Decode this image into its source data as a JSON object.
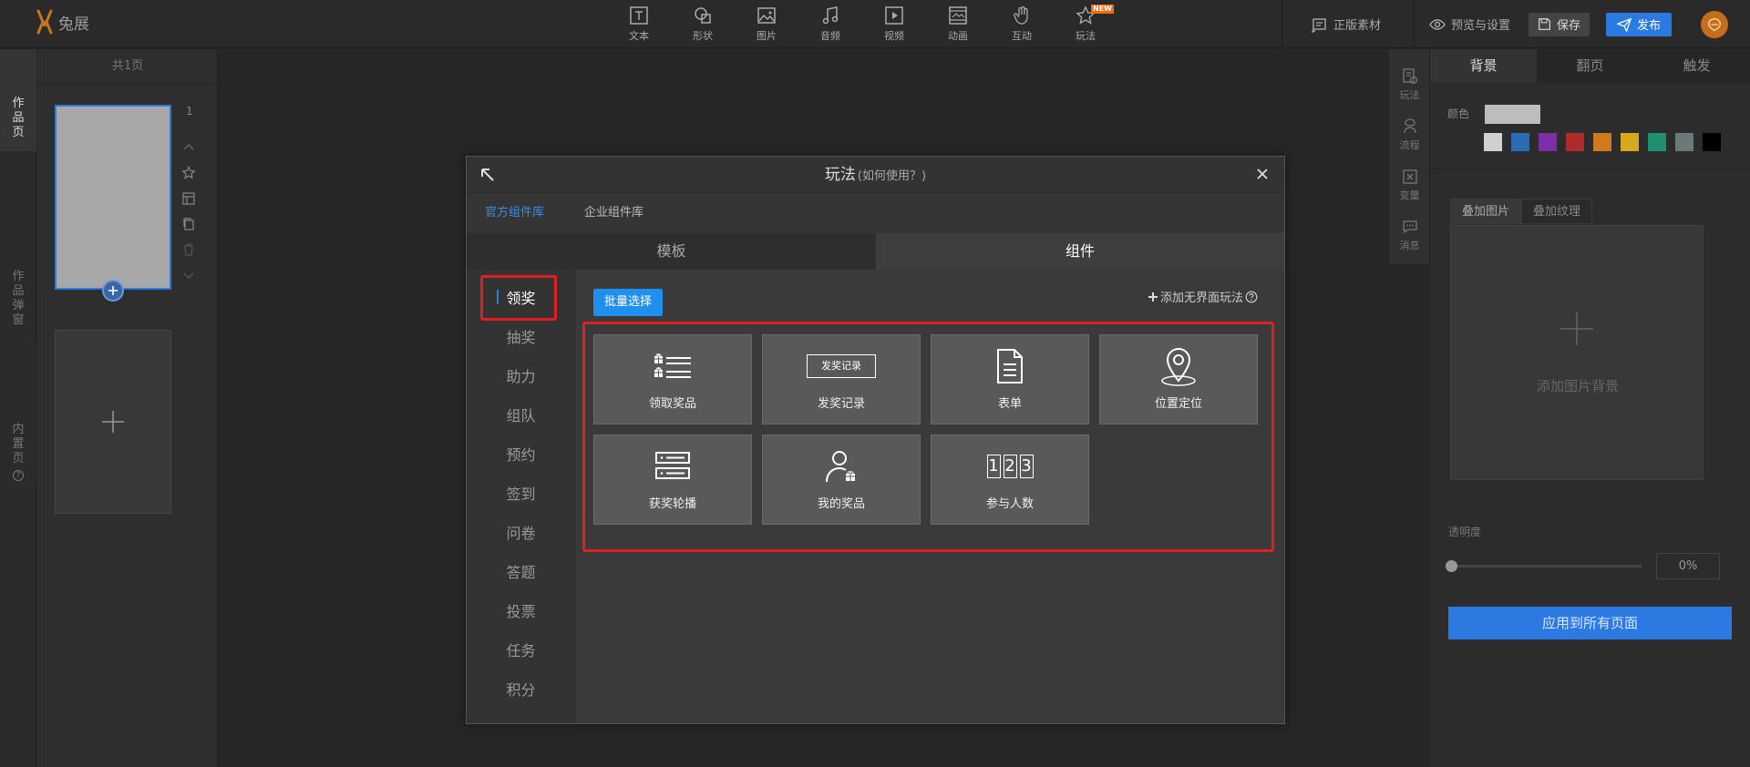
{
  "app": {
    "logo_text": "兔展"
  },
  "toolbar": {
    "tools": [
      {
        "label": "文本",
        "icon": "text-icon"
      },
      {
        "label": "形状",
        "icon": "shape-icon"
      },
      {
        "label": "图片",
        "icon": "image-icon"
      },
      {
        "label": "音频",
        "icon": "music-icon"
      },
      {
        "label": "视频",
        "icon": "video-icon"
      },
      {
        "label": "动画",
        "icon": "animation-icon"
      },
      {
        "label": "互动",
        "icon": "hand-icon"
      },
      {
        "label": "玩法",
        "icon": "star-icon",
        "badge": "NEW"
      }
    ],
    "licensed": "正版素材",
    "preview": "预览与设置",
    "save": "保存",
    "publish": "发布"
  },
  "left_tabs": {
    "works_page": [
      "作",
      "品",
      "页"
    ],
    "works_popup": [
      "作",
      "品",
      "弹",
      "窗"
    ],
    "builtin_page": [
      "内",
      "置",
      "页"
    ]
  },
  "page_panel": {
    "count_label": "共1页",
    "page_number": "1"
  },
  "right_sub": [
    {
      "label": "玩法",
      "icon": "playmode-icon"
    },
    {
      "label": "流程",
      "icon": "flow-icon"
    },
    {
      "label": "变量",
      "icon": "variable-icon"
    },
    {
      "label": "消息",
      "icon": "message-icon"
    }
  ],
  "right_panel": {
    "tabs": [
      "背景",
      "翻页",
      "触发"
    ],
    "color_label": "颜色",
    "colors": {
      "current": "#bdbdbd",
      "palette": [
        "#d0d0d0",
        "#2a6db5",
        "#7b2fa6",
        "#b02a2a",
        "#d07a1e",
        "#d4a91e",
        "#1e9070",
        "#6a7a7a",
        "#000000"
      ]
    },
    "subtabs": [
      "叠加图片",
      "叠加纹理"
    ],
    "add_bg": "添加图片背景",
    "opacity_label": "透明度",
    "opacity_value": "0%",
    "apply_all": "应用到所有页面"
  },
  "modal": {
    "title": "玩法",
    "title_hint": "(如何使用？)",
    "lib_tabs": [
      "官方组件库",
      "企业组件库"
    ],
    "type_tabs": [
      "模板",
      "组件"
    ],
    "nav": [
      "领奖",
      "抽奖",
      "助力",
      "组队",
      "预约",
      "签到",
      "问卷",
      "答题",
      "投票",
      "任务",
      "积分"
    ],
    "batch_select": "批量选择",
    "add_no_ui": "添加无界面玩法",
    "cards": [
      {
        "label": "领取奖品",
        "icon": "gift-list-icon"
      },
      {
        "label": "发奖记录",
        "icon": "award-record-icon",
        "icon_text": "发奖记录"
      },
      {
        "label": "表单",
        "icon": "form-icon"
      },
      {
        "label": "位置定位",
        "icon": "location-pin-icon"
      },
      {
        "label": "获奖轮播",
        "icon": "carousel-icon"
      },
      {
        "label": "我的奖品",
        "icon": "user-gift-icon"
      },
      {
        "label": "参与人数",
        "icon": "counter-icon",
        "icon_text": "123"
      }
    ]
  }
}
